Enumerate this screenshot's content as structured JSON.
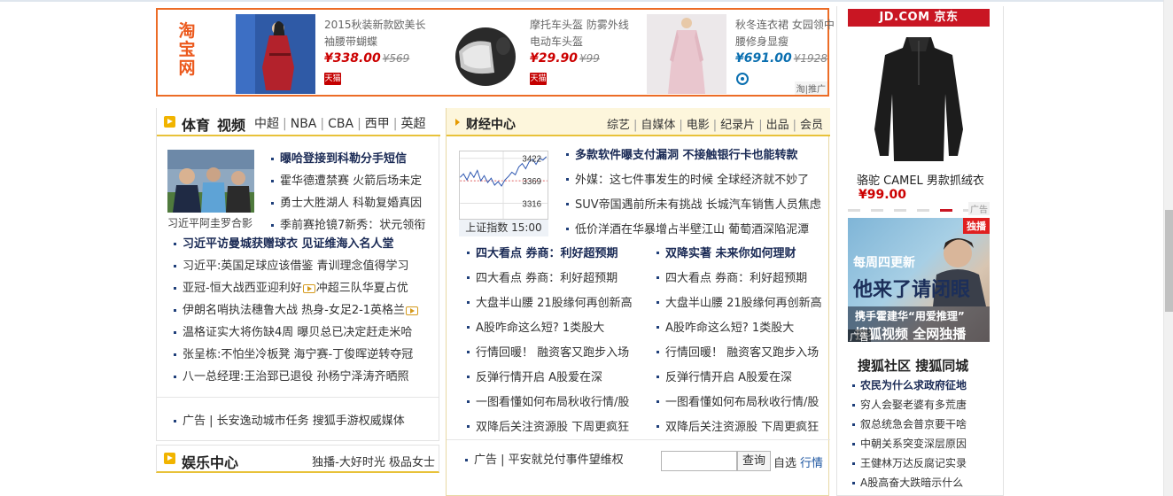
{
  "ad_banner": {
    "logo": [
      "淘",
      "宝",
      "网"
    ],
    "products": [
      {
        "name": "2015秋装新款欧美长袖腰带蝴蝶",
        "price": "¥338.00",
        "old_price": "¥569",
        "badge": "天猫"
      },
      {
        "name": "摩托车头盔 防雾外线电动车头盔",
        "price": "¥29.90",
        "old_price": "¥99",
        "badge": "天猫"
      },
      {
        "name": "秋冬连衣裙 女园领中腰修身显瘦",
        "price": "¥691.00",
        "old_price": "¥1928",
        "badge": ""
      }
    ],
    "corner": "淘|推广"
  },
  "sports": {
    "title1": "体育",
    "title2": "视频",
    "nav": [
      "中超",
      "NBA",
      "CBA",
      "西甲",
      "英超"
    ],
    "photo_caption": "习近平阿圭罗合影",
    "top_list": [
      {
        "text": "曝哈登接到科勒分手短信",
        "bold": true
      },
      {
        "text": "霍华德遭禁赛 火箭后场未定",
        "bold": false
      },
      {
        "text": "勇士大胜湖人 科勒复婚真因",
        "bold": false
      },
      {
        "text": "季前赛抢镜7新秀：状元领衔",
        "bold": false
      }
    ],
    "list": [
      {
        "text": "习近平访曼城获赠球衣 见证维海入名人堂",
        "bold": true
      },
      {
        "text": "习近平:英国足球应该借鉴 青训理念值得学习",
        "bold": false
      },
      {
        "text": "亚冠-恒大战西亚迎利好",
        "tail": "冲超三队华夏占优",
        "bold": false,
        "video": true
      },
      {
        "text": "伊朗名哨执法穗鲁大战 热身-女足2-1英格兰",
        "bold": false,
        "video_end": true
      },
      {
        "text": "温格证实大将伤缺4周 曝贝总已决定赶走米哈",
        "bold": false
      },
      {
        "text": "张呈栋:不怕坐冷板凳 海宁赛-丁俊晖逆转夺冠",
        "bold": false
      },
      {
        "text": "八一总经理:王治郅已退役 孙杨宁泽涛齐晒照",
        "bold": false
      }
    ],
    "ad_line": "广告 | 长安逸动城市任务 搜狐手游权威媒体"
  },
  "ent": {
    "title": "娱乐中心",
    "right": "独播-大好时光 极品女士"
  },
  "finance": {
    "title": "财经中心",
    "nav": [
      "综艺",
      "自媒体",
      "电影",
      "纪录片",
      "出品",
      "会员"
    ],
    "chart_caption": "上证指数 15:00",
    "chart_ticks": [
      "3422",
      "3369",
      "3316"
    ],
    "top_list": [
      {
        "text": "多款软件曝支付漏洞 不接触银行卡也能转款",
        "bold": true
      },
      {
        "text": "外媒：这七件事发生的时候 全球经济就不妙了",
        "bold": false
      },
      {
        "text": "SUV帝国遇前所未有挑战 长城汽车销售人员焦虑",
        "bold": false
      },
      {
        "text": "低价洋酒在华暴增占半壁江山 葡萄酒深陷泥潭",
        "bold": false
      }
    ],
    "left_list": [
      {
        "text": "四大看点 券商：利好超预期",
        "bold": true
      },
      {
        "text": "四大看点 券商：利好超预期",
        "bold": false
      },
      {
        "text": "大盘半山腰 21股缘何再创新高",
        "bold": false
      },
      {
        "text": "A股咋命这么短? 1类股大",
        "bold": false
      },
      {
        "text": "行情回暖！ 融资客又跑步入场",
        "bold": false
      },
      {
        "text": "反弹行情开启 A股爱在深",
        "bold": false
      },
      {
        "text": "一图看懂如何布局秋收行情/股",
        "bold": false
      },
      {
        "text": "双降后关注资源股 下周更疯狂",
        "bold": false
      }
    ],
    "right_list": [
      {
        "text": "双降实著 未来你如何理财",
        "bold": true
      },
      {
        "text": "四大看点 券商：利好超预期",
        "bold": false
      },
      {
        "text": "大盘半山腰 21股缘何再创新高",
        "bold": false
      },
      {
        "text": "A股咋命这么短? 1类股大",
        "bold": false
      },
      {
        "text": "行情回暖！ 融资客又跑步入场",
        "bold": false
      },
      {
        "text": "反弹行情开启 A股爱在深",
        "bold": false
      },
      {
        "text": "一图看懂如何布局秋收行情/股",
        "bold": false
      },
      {
        "text": "双降后关注资源股 下周更疯狂",
        "bold": false
      }
    ],
    "ad_line": "广告 | 平安就兑付事件望维权",
    "search_button": "查询",
    "link1": "自选",
    "link2": "行情"
  },
  "right": {
    "jd_logo": "JD.COM 京东",
    "jd_name": "骆驼 CAMEL 男款抓绒衣",
    "jd_price": "¥99.00",
    "ad_tag": "广告",
    "sohu_tag": "独播",
    "sohu_t1": "每周四更新",
    "sohu_t2": "他来了请闭眼",
    "sohu_t3": "携手霍建华“用爱推理”",
    "sohu_t4": "搜狐视频 全网独播",
    "sohu_ad": "广告",
    "title": "搜狐社区 搜狐同城",
    "list": [
      {
        "text": "农民为什么求政府征地",
        "bold": true
      },
      {
        "text": "穷人会娶老婆有多荒唐",
        "bold": false
      },
      {
        "text": "叙总统急会普京要干啥",
        "bold": false
      },
      {
        "text": "中朝关系突变深层原因",
        "bold": false
      },
      {
        "text": "王健林万达反腐记实录",
        "bold": false
      },
      {
        "text": "A股高奋大跌暗示什么",
        "bold": false
      }
    ]
  }
}
